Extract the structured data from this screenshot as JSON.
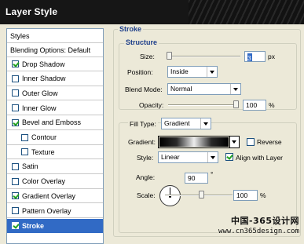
{
  "window": {
    "title": "Layer Style"
  },
  "sidebar": {
    "header": "Styles",
    "blending": "Blending Options: Default",
    "items": [
      {
        "label": "Drop Shadow",
        "checked": true
      },
      {
        "label": "Inner Shadow",
        "checked": false
      },
      {
        "label": "Outer Glow",
        "checked": false
      },
      {
        "label": "Inner Glow",
        "checked": false
      },
      {
        "label": "Bevel and Emboss",
        "checked": true
      },
      {
        "label": "Contour",
        "checked": false
      },
      {
        "label": "Texture",
        "checked": false
      },
      {
        "label": "Satin",
        "checked": false
      },
      {
        "label": "Color Overlay",
        "checked": false
      },
      {
        "label": "Gradient Overlay",
        "checked": true
      },
      {
        "label": "Pattern Overlay",
        "checked": false
      },
      {
        "label": "Stroke",
        "checked": true,
        "selected": true
      }
    ]
  },
  "stroke": {
    "section_title": "Stroke",
    "structure_title": "Structure",
    "size_label": "Size:",
    "size_value": "3",
    "size_unit": "px",
    "position_label": "Position:",
    "position_value": "Inside",
    "blend_mode_label": "Blend Mode:",
    "blend_mode_value": "Normal",
    "opacity_label": "Opacity:",
    "opacity_value": "100",
    "opacity_unit": "%",
    "fill_type_label": "Fill Type:",
    "fill_type_value": "Gradient",
    "gradient_label": "Gradient:",
    "reverse_label": "Reverse",
    "reverse_checked": false,
    "style_label": "Style:",
    "style_value": "Linear",
    "align_label": "Align with Layer",
    "align_checked": true,
    "angle_label": "Angle:",
    "angle_value": "90",
    "angle_unit": "°",
    "scale_label": "Scale:",
    "scale_value": "100",
    "scale_unit": "%"
  },
  "watermark": {
    "cn": "中国-365设计网",
    "url": "www.cn365design.com"
  }
}
